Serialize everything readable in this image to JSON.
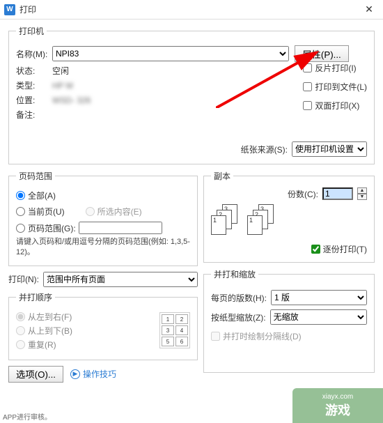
{
  "titlebar": {
    "app_icon": "W",
    "title": "打印"
  },
  "printer": {
    "legend": "打印机",
    "name_label": "名称(M):",
    "name_value": "NPI83",
    "properties_btn": "属性(P)...",
    "status_label": "状态:",
    "status_value": "空闲",
    "type_label": "类型:",
    "type_value": "HP M",
    "location_label": "位置:",
    "location_value": "WSD-                                   326",
    "comment_label": "备注:",
    "flip_label": "反片打印(I)",
    "to_file_label": "打印到文件(L)",
    "duplex_label": "双面打印(X)",
    "paper_source_label": "纸张来源(S):",
    "paper_source_value": "使用打印机设置"
  },
  "page_range": {
    "legend": "页码范围",
    "all": "全部(A)",
    "current": "当前页(U)",
    "selection": "所选内容(E)",
    "range": "页码范围(G):",
    "note": "请键入页码和/或用逗号分隔的页码范围(例如: 1,3,5-12)。"
  },
  "copies": {
    "legend": "副本",
    "label": "份数(C):",
    "value": "1",
    "collate": "逐份打印(T)"
  },
  "print_what": {
    "label": "打印(N):",
    "value": "范围中所有页面"
  },
  "order": {
    "legend": "并打顺序",
    "lr": "从左到右(F)",
    "tb": "从上到下(B)",
    "repeat": "重复(R)"
  },
  "scale": {
    "legend": "并打和缩放",
    "pages_per_sheet_label": "每页的版数(H):",
    "pages_per_sheet_value": "1 版",
    "paper_scale_label": "按纸型缩放(Z):",
    "paper_scale_value": "无缩放",
    "draw_border": "并打时绘制分隔线(D)"
  },
  "bottom": {
    "options_btn": "选项(O)...",
    "tips": "操作技巧"
  },
  "watermark": {
    "site": "xiayx.com",
    "brand": "游戏"
  },
  "footer_note": "APP进行审核。",
  "mini_grid": [
    "1",
    "2",
    "3",
    "4",
    "5",
    "6"
  ],
  "stack_labels": [
    "3",
    "2",
    "1"
  ]
}
